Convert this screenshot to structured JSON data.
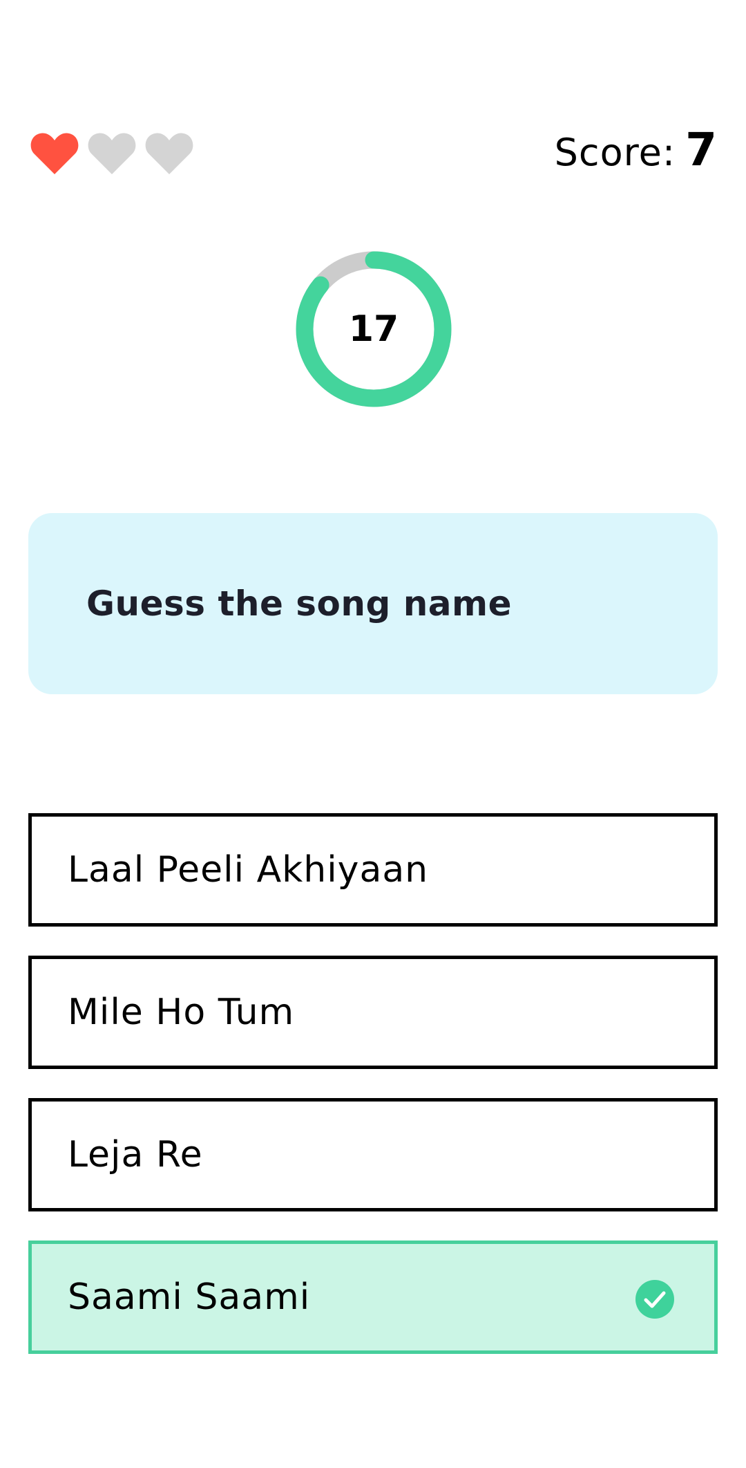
{
  "lives": {
    "total": 3,
    "remaining": 1,
    "active_color": "#ff5240",
    "inactive_color": "#d4d4d4",
    "icon": "heart-icon"
  },
  "score": {
    "label": "Score:",
    "value": "7"
  },
  "timer": {
    "seconds": "17",
    "progress_fraction": 0.86,
    "track_color": "#cccccc",
    "progress_color": "#44d49c"
  },
  "question": {
    "text": "Guess the song name",
    "background": "#dbf6fc"
  },
  "options": [
    {
      "label": "Laal Peeli Akhiyaan",
      "state": "default"
    },
    {
      "label": "Mile Ho Tum",
      "state": "default"
    },
    {
      "label": "Leja Re",
      "state": "default"
    },
    {
      "label": "Saami Saami",
      "state": "correct",
      "icon": "check-circle-icon"
    }
  ],
  "colors": {
    "correct_border": "#47cf9c",
    "correct_background": "#cbf5e5",
    "check_icon": "#3fd29b"
  }
}
